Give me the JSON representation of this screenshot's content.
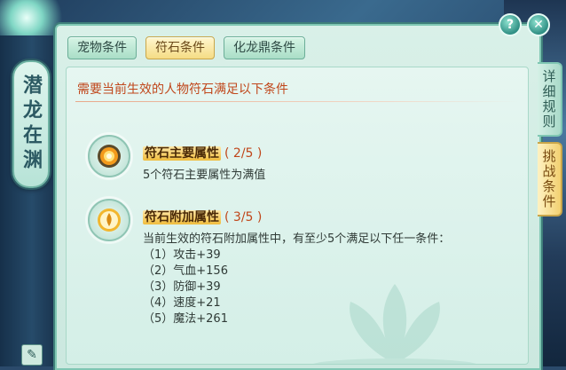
{
  "left_banner": {
    "title": "潜龙在渊"
  },
  "header_buttons": {
    "help_label": "?",
    "close_label": "✕"
  },
  "tabs": [
    {
      "label": "宠物条件",
      "active": false
    },
    {
      "label": "符石条件",
      "active": true
    },
    {
      "label": "化龙鼎条件",
      "active": false
    }
  ],
  "side_tabs": [
    {
      "label": "详细规则",
      "active": false
    },
    {
      "label": "挑战条件",
      "active": true
    }
  ],
  "content": {
    "heading": "需要当前生效的人物符石满足以下条件",
    "items": [
      {
        "title": "符石主要属性",
        "count": "( 2/5 )",
        "icon": "fire-orb-icon",
        "lines": [
          "5个符石主要属性为满值"
        ]
      },
      {
        "title": "符石附加属性",
        "count": "( 3/5 )",
        "icon": "flame-ring-icon",
        "lines": [
          "当前生效的符石附加属性中，有至少5个满足以下任一条件：",
          "（1）攻击+39",
          "（2）气血+156",
          "（3）防御+39",
          "（4）速度+21",
          "（5）魔法+261"
        ]
      }
    ]
  },
  "colors": {
    "accent_red": "#c0471b",
    "tab_active": "#f5dc84",
    "panel_bg": "#d9f0e8"
  }
}
